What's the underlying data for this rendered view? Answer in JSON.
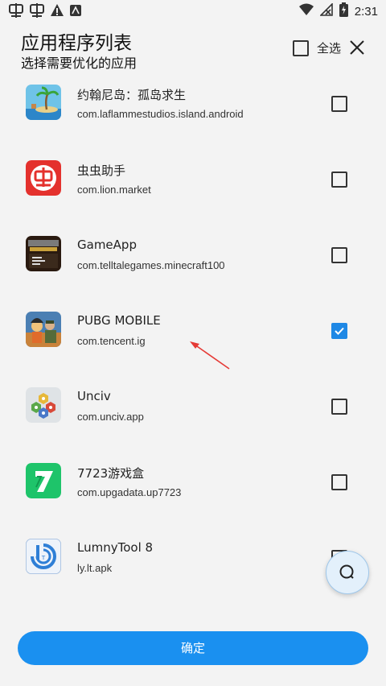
{
  "status_bar": {
    "time": "2:31",
    "left_icons": [
      "chongchong-icon",
      "chongchong-icon",
      "warning-icon",
      "notification-icon"
    ],
    "right_icons": [
      "wifi-icon",
      "no-signal-icon",
      "battery-charging-icon"
    ]
  },
  "header": {
    "title": "应用程序列表",
    "subtitle": "选择需要优化的应用",
    "select_all_label": "全选"
  },
  "apps": [
    {
      "name": "约翰尼岛：孤岛求生",
      "package": "com.laflammestudios.island.android",
      "checked": false,
      "icon": "island-game-icon"
    },
    {
      "name": "虫虫助手",
      "package": "com.lion.market",
      "checked": false,
      "icon": "chongchong-app-icon"
    },
    {
      "name": "GameApp",
      "package": "com.telltalegames.minecraft100",
      "checked": false,
      "icon": "minecraft-story-icon"
    },
    {
      "name": "PUBG MOBILE",
      "package": "com.tencent.ig",
      "checked": true,
      "icon": "pubg-icon"
    },
    {
      "name": "Unciv",
      "package": "com.unciv.app",
      "checked": false,
      "icon": "unciv-icon"
    },
    {
      "name": "7723游戏盒",
      "package": "com.upgadata.up7723",
      "checked": false,
      "icon": "7723-icon"
    },
    {
      "name": "LumnyTool 8",
      "package": "ly.lt.apk",
      "checked": false,
      "icon": "lumnytool-icon"
    }
  ],
  "confirm_label": "确定",
  "colors": {
    "accent": "#1a90f0",
    "checkbox_checked": "#1e88e5",
    "background": "#f3f3f3",
    "annotation_arrow": "#e53935"
  }
}
